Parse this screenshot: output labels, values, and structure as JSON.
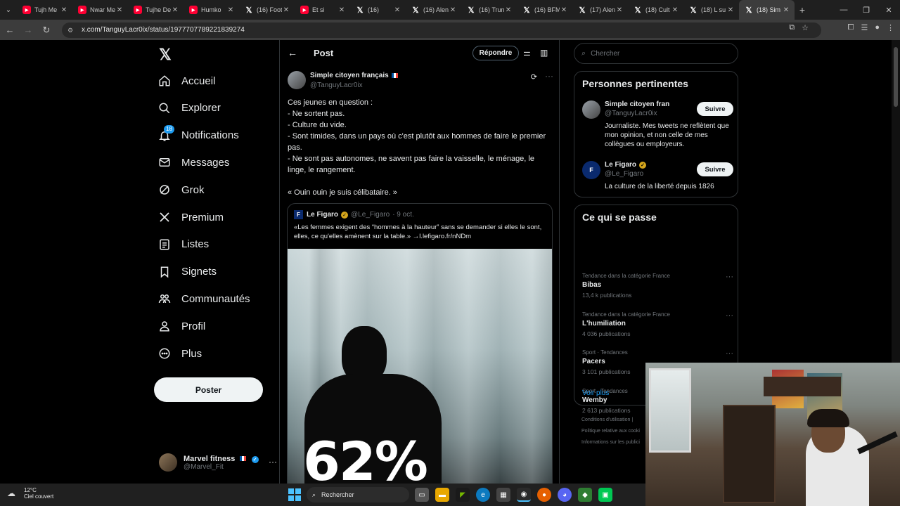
{
  "browser": {
    "tabs": [
      {
        "title": "Tujh Me",
        "icon": "youtube-icon"
      },
      {
        "title": "Nwar Me",
        "icon": "youtube-icon"
      },
      {
        "title": "Tujhe De",
        "icon": "youtube-icon"
      },
      {
        "title": "Humko",
        "icon": "youtube-icon"
      },
      {
        "title": "(16) Foot",
        "icon": "x-icon"
      },
      {
        "title": "Et si",
        "icon": "youtube-icon"
      },
      {
        "title": "(16)",
        "icon": "x-icon"
      },
      {
        "title": "(16) Alen",
        "icon": "x-icon"
      },
      {
        "title": "(16) Trun",
        "icon": "x-icon"
      },
      {
        "title": "(16) BFM",
        "icon": "x-icon"
      },
      {
        "title": "(17) Alen",
        "icon": "x-icon"
      },
      {
        "title": "(18) Cult",
        "icon": "x-icon"
      },
      {
        "title": "(18) L su",
        "icon": "x-icon"
      },
      {
        "title": "(18) Sim",
        "icon": "x-icon",
        "active": true
      }
    ],
    "url": "x.com/TanguyLacr0ix/status/1977707789221839274"
  },
  "nav": {
    "items": [
      {
        "label": "Accueil",
        "icon": "home-icon"
      },
      {
        "label": "Explorer",
        "icon": "search-icon"
      },
      {
        "label": "Notifications",
        "icon": "bell-icon",
        "badge": "18"
      },
      {
        "label": "Messages",
        "icon": "envelope-icon"
      },
      {
        "label": "Grok",
        "icon": "grok-icon"
      },
      {
        "label": "Premium",
        "icon": "x-icon"
      },
      {
        "label": "Listes",
        "icon": "list-icon"
      },
      {
        "label": "Signets",
        "icon": "bookmark-icon"
      },
      {
        "label": "Communautés",
        "icon": "people-icon"
      },
      {
        "label": "Profil",
        "icon": "person-icon"
      },
      {
        "label": "Plus",
        "icon": "more-circle-icon"
      }
    ],
    "post_button": "Poster",
    "account": {
      "name": "Marvel fitness",
      "handle": "@Marvel_Fit"
    }
  },
  "main": {
    "title": "Post",
    "reply_button": "Répondre",
    "author": {
      "name": "Simple citoyen français",
      "handle": "@TanguyLacr0ix"
    },
    "text_lines": [
      "Ces jeunes en question :",
      "- Ne sortent pas.",
      "- Culture du vide.",
      "- Sont timides, dans un pays où c'est plutôt aux hommes de faire le premier pas.",
      "- Ne sont pas autonomes, ne savent pas faire la vaisselle, le ménage, le linge, le rangement.",
      "",
      "« Ouin ouin je suis célibataire. »"
    ],
    "quote": {
      "name": "Le Figaro",
      "handle": "@Le_Figaro",
      "date": "· 9 oct.",
      "text": "«Les femmes exigent des “hommes à la hauteur” sans se demander si elles le sont, elles, ce qu'elles amènent sur la table.» →l.lefigaro.fr/nNDm",
      "image_overlay": "62%"
    }
  },
  "right": {
    "search_placeholder": "Chercher",
    "people_title": "Personnes pertinentes",
    "people": [
      {
        "name": "Simple citoyen françai...",
        "handle": "@TanguyLacr0ix",
        "bio": "Journaliste. Mes tweets ne reflètent que mon opinion, et non celle de mes collègues ou employeurs.",
        "follow": "Suivre"
      },
      {
        "name": "Le Figaro",
        "handle": "@Le_Figaro",
        "bio": "La culture de la liberté depuis 1826",
        "follow": "Suivre"
      }
    ],
    "trends_title": "Ce qui se passe",
    "trends": [
      {
        "category": "Tendance dans la catégorie France",
        "name": "Bibas",
        "count": "13,4 k publications"
      },
      {
        "category": "Tendance dans la catégorie France",
        "name": "L'humiliation",
        "count": "4 036 publications"
      },
      {
        "category": "Sport · Tendances",
        "name": "Pacers",
        "count": "3 101 publications"
      },
      {
        "category": "Sport · Tendances",
        "name": "Wemby",
        "count": "2 613 publications"
      }
    ],
    "see_more": "Voir plus",
    "footer": [
      "Conditions d'utilisation  |",
      "Politique relative aux cooki",
      "Informations sur les publici"
    ]
  },
  "taskbar": {
    "temperature": "12°C",
    "weather": "Ciel couvert",
    "search_label": "Rechercher"
  },
  "colors": {
    "accent": "#1d9bf0",
    "background": "#000000",
    "border": "#2f3336"
  }
}
